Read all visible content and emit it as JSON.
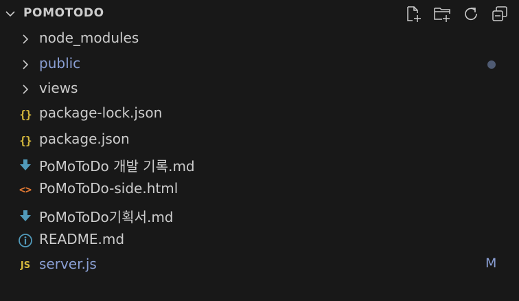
{
  "explorer": {
    "section_title": "POMOTODO",
    "actions": [
      {
        "name": "new-file",
        "icon": "new-file-icon"
      },
      {
        "name": "new-folder",
        "icon": "new-folder-icon"
      },
      {
        "name": "refresh",
        "icon": "refresh-icon"
      },
      {
        "name": "collapse-all",
        "icon": "collapse-all-icon"
      }
    ],
    "items": [
      {
        "label": "node_modules",
        "type": "folder",
        "icon": "chevron-right-icon"
      },
      {
        "label": "public",
        "type": "folder",
        "icon": "chevron-right-icon",
        "decoration": "dot"
      },
      {
        "label": "views",
        "type": "folder",
        "icon": "chevron-right-icon"
      },
      {
        "label": "package-lock.json",
        "type": "file",
        "icon": "json-icon",
        "icon_text": "{}"
      },
      {
        "label": "package.json",
        "type": "file",
        "icon": "json-icon",
        "icon_text": "{}"
      },
      {
        "label": "PoMoToDo 개발 기록.md",
        "type": "file",
        "icon": "markdown-icon"
      },
      {
        "label": "PoMoToDo-side.html",
        "type": "file",
        "icon": "html-icon",
        "icon_text": "<>"
      },
      {
        "label": "PoMoToDo기획서.md",
        "type": "file",
        "icon": "markdown-icon"
      },
      {
        "label": "README.md",
        "type": "file",
        "icon": "info-icon"
      },
      {
        "label": "server.js",
        "type": "file",
        "icon": "js-icon",
        "icon_text": "JS",
        "git_status": "M"
      }
    ]
  },
  "colors": {
    "background": "#181818",
    "text": "#cccccc",
    "modified": "#8a9fd4",
    "json_icon": "#d7ba3d",
    "markdown_icon": "#519aba",
    "html_icon": "#e37933",
    "dot": "#4f5b73"
  }
}
